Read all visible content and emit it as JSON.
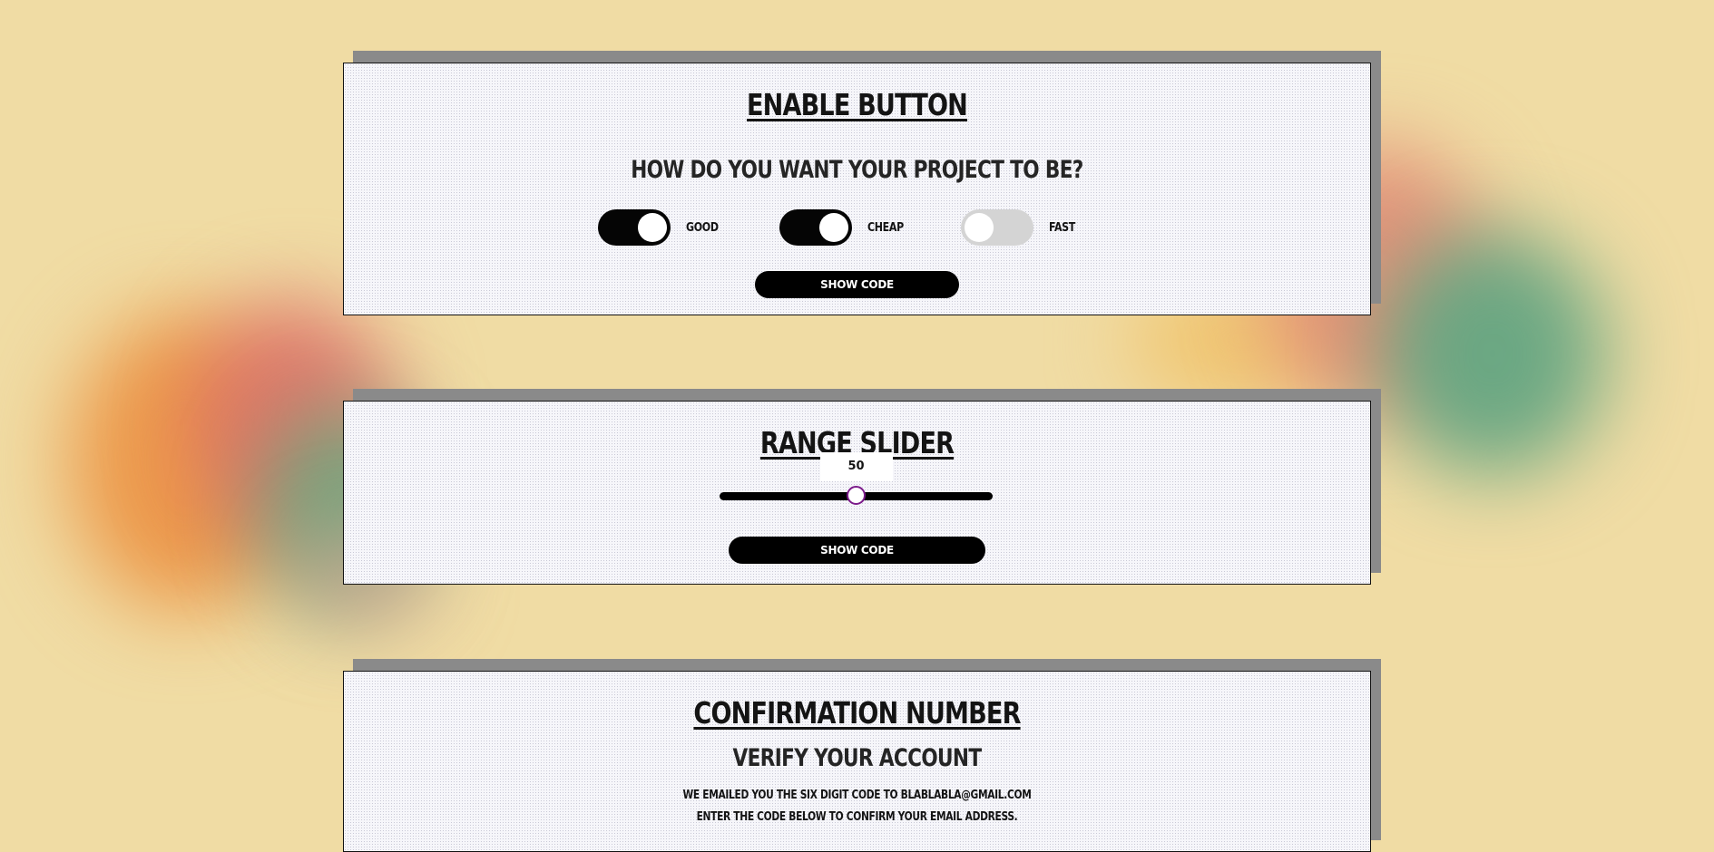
{
  "colors": {
    "page_background": "#f0dca4",
    "card_shadow": "#8a8a8a",
    "toggle_on": "#050505",
    "toggle_off": "#d4d4d4",
    "slider_thumb_border": "#7b1a8a"
  },
  "enable_button": {
    "title": "ENABLE BUTTON",
    "question": "HOW DO YOU WANT YOUR PROJECT TO BE?",
    "toggles": [
      {
        "label": "GOOD",
        "checked": true
      },
      {
        "label": "CHEAP",
        "checked": true
      },
      {
        "label": "FAST",
        "checked": false
      }
    ],
    "show_code_label": "SHOW CODE"
  },
  "range_slider": {
    "title": "RANGE SLIDER",
    "value": "50",
    "min": 0,
    "max": 100,
    "show_code_label": "SHOW CODE"
  },
  "confirmation_number": {
    "title": "CONFIRMATION NUMBER",
    "subtitle": "VERIFY YOUR ACCOUNT",
    "line1": "WE EMAILED YOU THE SIX DIGIT CODE TO BLABLABLA@GMAIL.COM",
    "line2": "ENTER THE CODE BELOW TO CONFIRM YOUR EMAIL ADDRESS."
  }
}
